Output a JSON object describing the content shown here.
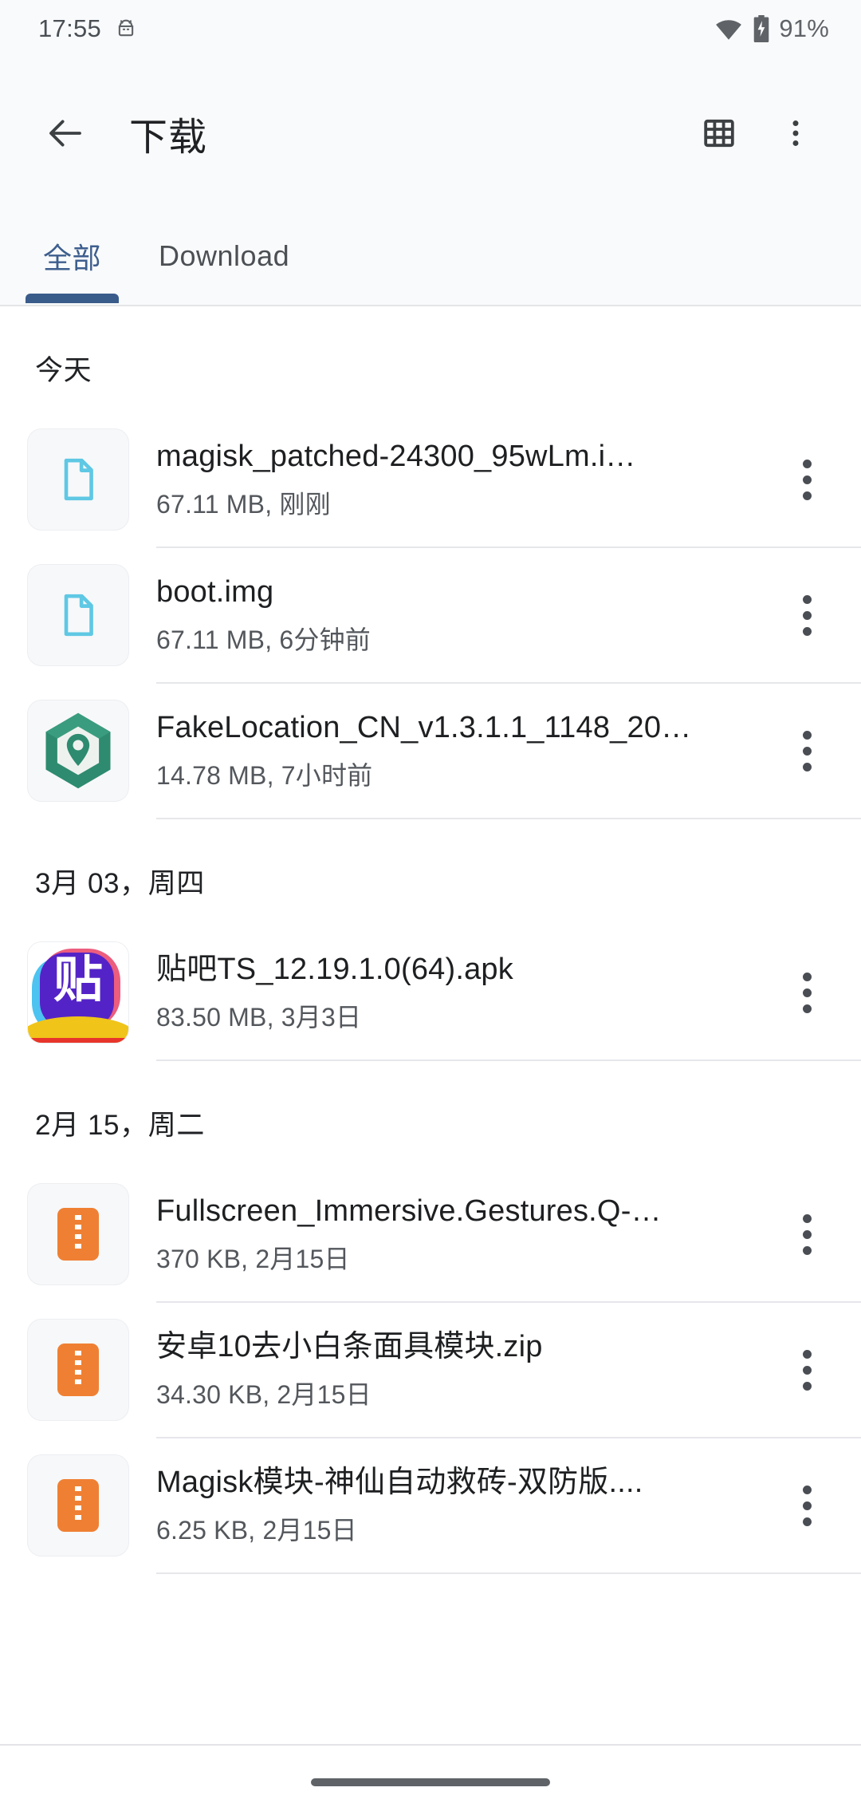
{
  "status_bar": {
    "time": "17:55",
    "notification_icon": "android-head-icon",
    "wifi_icon": "wifi-icon",
    "battery_icon": "battery-charging-icon",
    "battery_level": "91%"
  },
  "app_bar": {
    "back_icon": "back-arrow-icon",
    "title": "下载",
    "grid_view_icon": "grid-view-icon",
    "overflow_icon": "more-vert-icon"
  },
  "tabs": {
    "items": [
      {
        "label": "全部",
        "active": true
      },
      {
        "label": "Download",
        "active": false
      }
    ],
    "active_color": "#3a5c8b",
    "inactive_color": "#4c5055"
  },
  "groups": [
    {
      "date_label": "今天",
      "files": [
        {
          "name": "magisk_patched-24300_95wLm.i…",
          "meta": "67.11 MB, 刚刚",
          "icon": "document-file-icon",
          "icon_color": "#5fc8e4"
        },
        {
          "name": "boot.img",
          "meta": "67.11 MB, 6分钟前",
          "icon": "document-file-icon",
          "icon_color": "#5fc8e4"
        },
        {
          "name": "FakeLocation_CN_v1.3.1.1_1148_20…",
          "meta": "14.78 MB, 7小时前",
          "icon": "fakelocation-app-icon",
          "icon_color": "#2e8b6f"
        }
      ]
    },
    {
      "date_label": "3月 03，周四",
      "files": [
        {
          "name": "贴吧TS_12.19.1.0(64).apk",
          "meta": "83.50 MB, 3月3日",
          "icon": "tieba-app-icon",
          "icon_color": "#5423c7",
          "glyph": "贴"
        }
      ]
    },
    {
      "date_label": "2月 15，周二",
      "files": [
        {
          "name": "Fullscreen_Immersive.Gestures.Q-…",
          "meta": "370 KB, 2月15日",
          "icon": "zip-archive-icon",
          "icon_color": "#ef8033"
        },
        {
          "name": "安卓10去小白条面具模块.zip",
          "meta": "34.30 KB, 2月15日",
          "icon": "zip-archive-icon",
          "icon_color": "#ef8033"
        },
        {
          "name": "Magisk模块-神仙自动救砖-双防版....",
          "meta": "6.25 KB, 2月15日",
          "icon": "zip-archive-icon",
          "icon_color": "#ef8033"
        }
      ]
    }
  ],
  "nav_bar": {
    "gesture_pill": "home-gesture-pill"
  }
}
